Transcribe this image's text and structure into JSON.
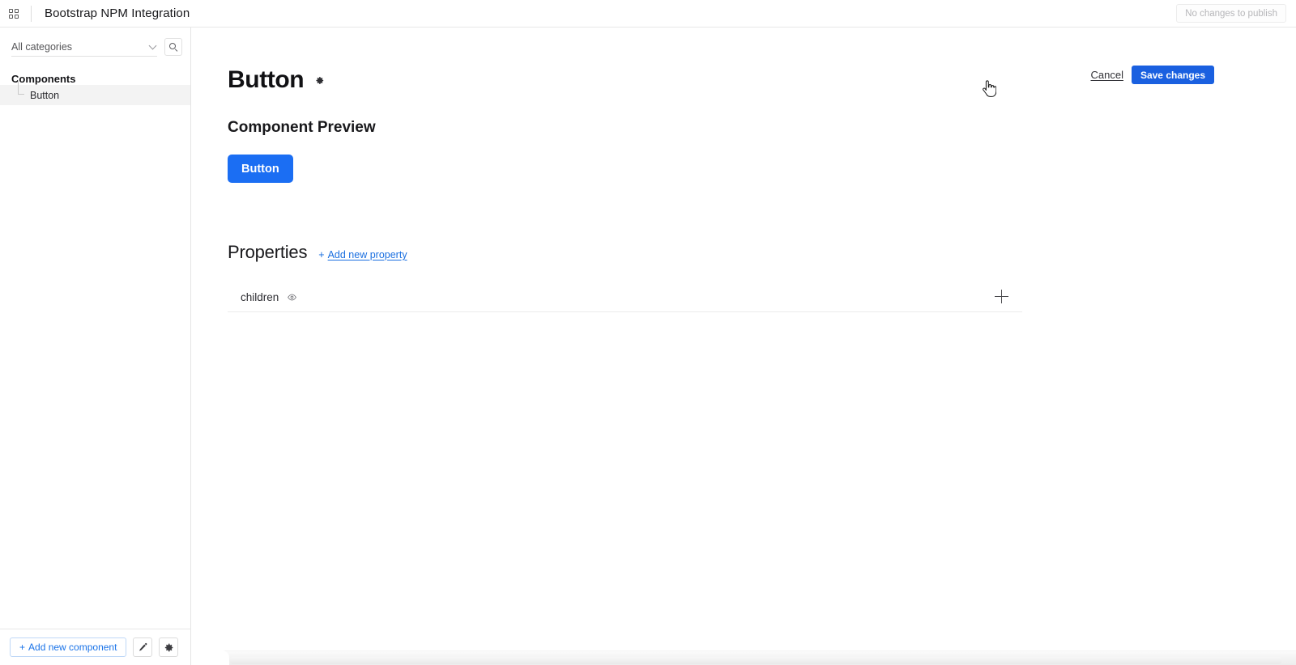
{
  "topbar": {
    "apps_icon": "grid-icon",
    "app_title": "Bootstrap NPM Integration",
    "publish_label": "No changes to publish"
  },
  "sidebar": {
    "category_select": {
      "value": "All categories",
      "chevron_icon": "chevron-down-icon"
    },
    "search_icon": "search-icon",
    "tree_heading": "Components",
    "tree_items": [
      {
        "label": "Button",
        "selected": true
      }
    ],
    "footer": {
      "add_component_plus": "+",
      "add_component_label": "Add new component",
      "edit_icon": "pencil-icon",
      "settings_icon": "gear-icon"
    }
  },
  "main": {
    "page_title": "Button",
    "title_settings_icon": "gear-icon",
    "cancel_label": "Cancel",
    "save_label": "Save changes",
    "cursor_icon": "pointer-hand-cursor",
    "preview_section_title": "Component Preview",
    "preview_button_label": "Button",
    "properties": {
      "title": "Properties",
      "add_property_plus": "+",
      "add_property_label": "Add new property",
      "rows": [
        {
          "name": "children",
          "visibility_icon": "eye-icon",
          "add_icon": "plus-icon"
        }
      ]
    }
  },
  "colors": {
    "accent_blue": "#1b6ef3",
    "save_blue": "#1a60e0",
    "link_blue": "#1a6fe0",
    "selected_row_bg": "#f3f3f3",
    "border": "#e4e4e4"
  }
}
